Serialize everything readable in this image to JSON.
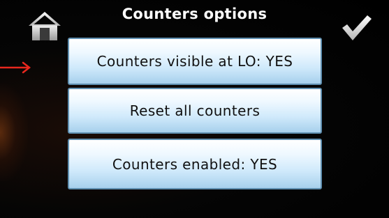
{
  "header": {
    "title": "Counters options"
  },
  "nav": {
    "home_icon": "home-icon",
    "confirm_icon": "checkmark-icon"
  },
  "options": [
    {
      "label": "Counters visible at LO: YES"
    },
    {
      "label": "Reset all counters"
    },
    {
      "label": "Counters enabled: YES"
    }
  ],
  "colors": {
    "background": "#000000",
    "button_top": "#ffffff",
    "button_bottom": "#a7d0ec",
    "button_border": "#5f8fb0",
    "pointer_arrow": "#e8281e"
  }
}
